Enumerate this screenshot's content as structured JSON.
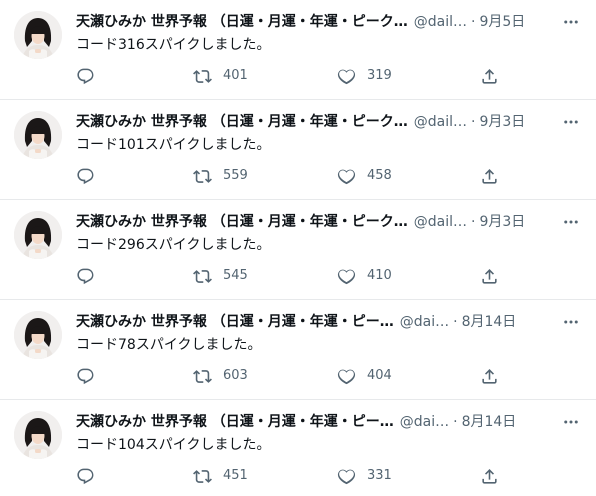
{
  "account": {
    "name_truncated": "天瀬ひみか 世界予報 （日運・月運・年運・ピーク…",
    "name_truncated_short": "天瀬ひみか 世界予報 （日運・月運・年運・ピー…",
    "handle": "@dail…",
    "handle_short": "@dai…",
    "dot": "·"
  },
  "colors": {
    "text": "#0f1419",
    "muted": "#536471",
    "divider": "#e7e9eb"
  },
  "icons": {
    "reply": "reply-icon",
    "retweet": "retweet-icon",
    "like": "like-icon",
    "share": "share-icon",
    "more": "more-icon"
  },
  "tweets": [
    {
      "date": "9月5日",
      "text": "コード316スパイクしました。",
      "retweets": "401",
      "likes": "319"
    },
    {
      "date": "9月3日",
      "text": "コード101スパイクしました。",
      "retweets": "559",
      "likes": "458"
    },
    {
      "date": "9月3日",
      "text": "コード296スパイクしました。",
      "retweets": "545",
      "likes": "410"
    },
    {
      "date": "8月14日",
      "text": "コード78スパイクしました。",
      "retweets": "603",
      "likes": "404"
    },
    {
      "date": "8月14日",
      "text": "コード104スパイクしました。",
      "retweets": "451",
      "likes": "331"
    }
  ]
}
